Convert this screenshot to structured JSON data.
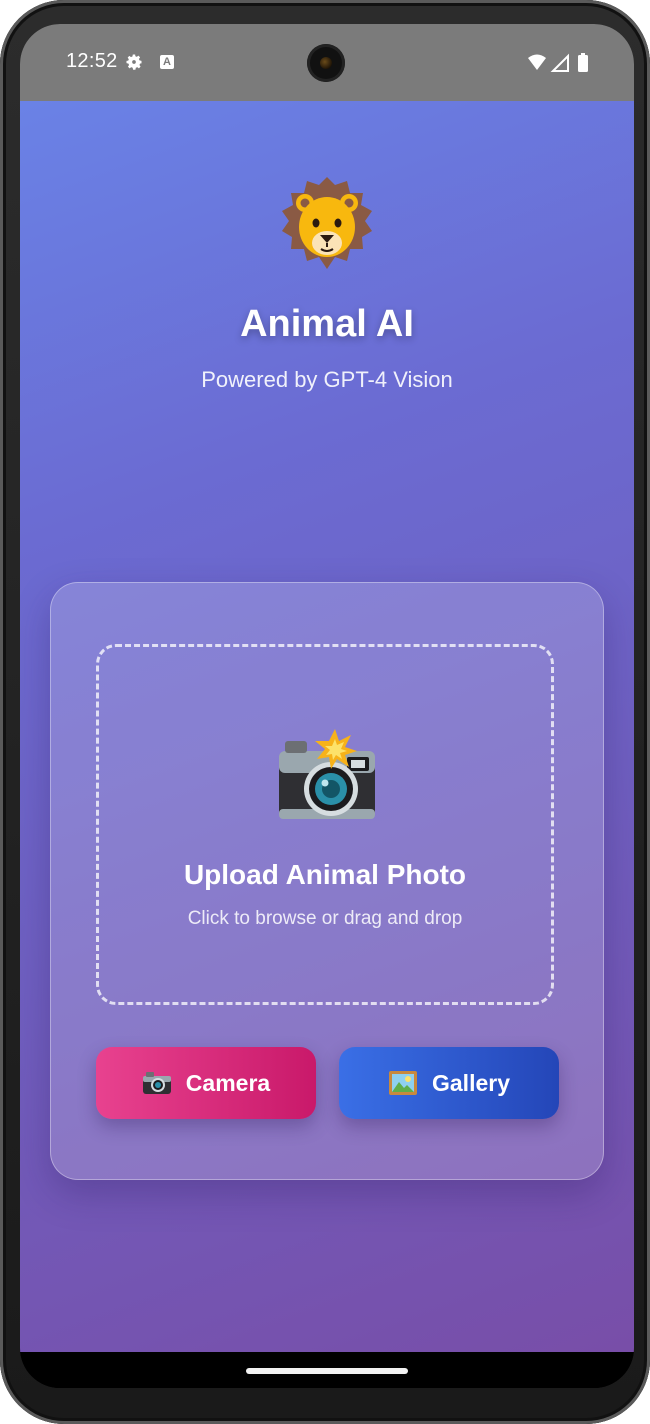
{
  "status_bar": {
    "time": "12:52",
    "icons": [
      "gear-icon",
      "a-badge-icon",
      "wifi-icon",
      "signal-icon",
      "battery-icon"
    ]
  },
  "app": {
    "logo_icon": "lion-face-icon",
    "title": "Animal AI",
    "subtitle": "Powered by GPT-4 Vision"
  },
  "upload": {
    "icon": "camera-with-flash-icon",
    "title": "Upload Animal Photo",
    "hint": "Click to browse or drag and drop"
  },
  "buttons": {
    "camera": {
      "label": "Camera",
      "icon": "camera-icon",
      "color": "#d92c7e"
    },
    "gallery": {
      "label": "Gallery",
      "icon": "framed-picture-icon",
      "color": "#2f5bd0"
    }
  },
  "theme": {
    "background_top": "#6a82e6",
    "background_bottom": "#784ea8"
  }
}
